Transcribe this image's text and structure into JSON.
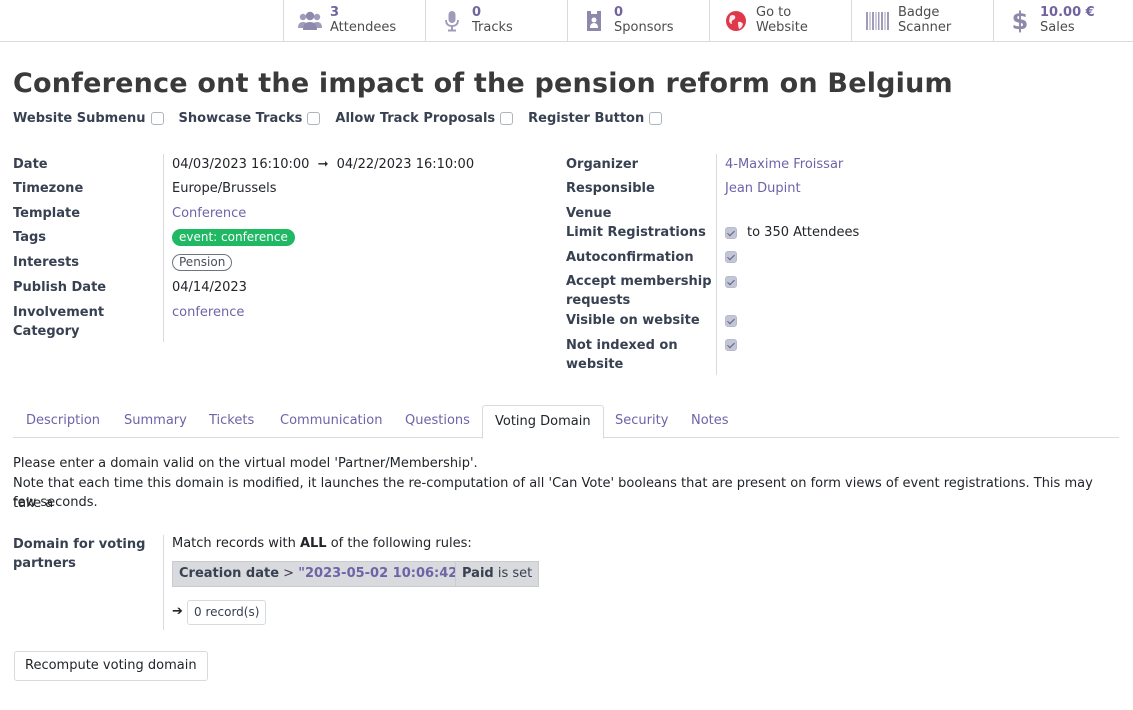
{
  "smart_buttons": [
    {
      "icon": "users-icon",
      "number": "3",
      "label": "Attendees"
    },
    {
      "icon": "microphone-icon",
      "number": "0",
      "label": "Tracks"
    },
    {
      "icon": "sponsor-badge-icon",
      "number": "0",
      "label": "Sponsors"
    },
    {
      "icon": "globe-icon",
      "number": "Go to",
      "label": "Website"
    },
    {
      "icon": "barcode-icon",
      "number": "Badge",
      "label": "Scanner"
    },
    {
      "icon": "dollar-icon",
      "number": "10.00 €",
      "label": "Sales"
    }
  ],
  "title": "Conference ont the impact of the pension reform on Belgium",
  "options": [
    {
      "label": "Website Submenu",
      "checked": false
    },
    {
      "label": "Showcase Tracks",
      "checked": false
    },
    {
      "label": "Allow Track Proposals",
      "checked": false
    },
    {
      "label": "Register Button",
      "checked": false
    }
  ],
  "left_group": {
    "date_label": "Date",
    "date_start": "04/03/2023 16:10:00",
    "date_arrow": "➞",
    "date_end": "04/22/2023 16:10:00",
    "timezone_label": "Timezone",
    "timezone": "Europe/Brussels",
    "template_label": "Template",
    "template": "Conference",
    "tags_label": "Tags",
    "tag": "event: conference",
    "interests_label": "Interests",
    "interest": "Pension",
    "publish_label": "Publish Date",
    "publish_date": "04/14/2023",
    "involvement_label_1": "Involvement",
    "involvement_label_2": "Category",
    "involvement": "conference"
  },
  "right_group": {
    "organizer_label": "Organizer",
    "organizer": "4-Maxime Froissar",
    "responsible_label": "Responsible",
    "responsible": "Jean Dupint",
    "venue_label": "Venue",
    "limit_label": "Limit Registrations",
    "limit_text": "to 350 Attendees",
    "autoconf_label": "Autoconfirmation",
    "membership_label_1": "Accept membership",
    "membership_label_2": "requests",
    "visible_label": "Visible on website",
    "notindexed_label_1": "Not indexed on",
    "notindexed_label_2": "website"
  },
  "tabs": [
    "Description",
    "Summary",
    "Tickets",
    "Communication",
    "Questions",
    "Voting Domain",
    "Security",
    "Notes"
  ],
  "active_tab": "Voting Domain",
  "voting": {
    "note_line1": "Please enter a domain valid on the virtual model 'Partner/Membership'.",
    "note_line2": "Note that each time this domain is modified, it launches the re-computation of all 'Can Vote' booleans that are present on form views of event registrations. This may take a",
    "note_line3": "few seconds.",
    "domain_label_1": "Domain for voting",
    "domain_label_2": "partners",
    "match_prefix": "Match records with ",
    "match_all": "ALL",
    "match_suffix": " of the following rules:",
    "rule1_field": "Creation date",
    "rule1_op": " > ",
    "rule1_value": "\"2023-05-02 10:06:42\"",
    "rule2_field": "Paid",
    "rule2_op": " is set",
    "record_count": "0 record(s)",
    "arrow": "➔",
    "recompute_label": "Recompute voting domain"
  }
}
